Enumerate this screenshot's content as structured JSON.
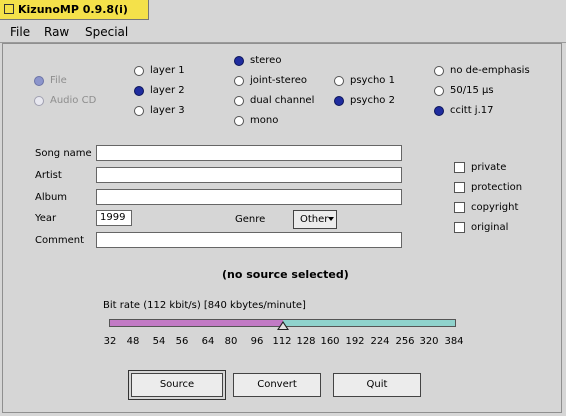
{
  "window": {
    "title": "KizunoMP 0.9.8(i)"
  },
  "menu": {
    "items": [
      "File",
      "Raw",
      "Special"
    ]
  },
  "source": {
    "options": [
      "File",
      "Audio CD"
    ],
    "selected": "File"
  },
  "layer": {
    "options": [
      "layer 1",
      "layer 2",
      "layer 3"
    ],
    "selected": "layer 2"
  },
  "mode": {
    "options": [
      "stereo",
      "joint-stereo",
      "dual channel",
      "mono"
    ],
    "selected": "stereo"
  },
  "psycho": {
    "options": [
      "psycho 1",
      "psycho 2"
    ],
    "selected": "psycho 2"
  },
  "emphasis": {
    "options": [
      "no de-emphasis",
      "50/15 μs",
      "ccitt j.17"
    ],
    "selected": "ccitt j.17"
  },
  "fields": {
    "song_label": "Song name",
    "song_value": "",
    "artist_label": "Artist",
    "artist_value": "",
    "album_label": "Album",
    "album_value": "",
    "year_label": "Year",
    "year_value": "1999",
    "comment_label": "Comment",
    "comment_value": "",
    "genre_label": "Genre",
    "genre_value": "Other"
  },
  "flags": {
    "items": [
      "private",
      "protection",
      "copyright",
      "original"
    ],
    "checked": [
      false,
      false,
      false,
      false
    ]
  },
  "status": "(no source selected)",
  "bitrate": {
    "label": "Bit rate (112 kbit/s) [840 kbytes/minute]",
    "value": 112,
    "ticks": [
      "32",
      "48",
      "54",
      "56",
      "64",
      "80",
      "96",
      "112",
      "128",
      "160",
      "192",
      "224",
      "256",
      "320",
      "384"
    ],
    "left_color": "#c27ac5",
    "right_color": "#8fd2cc"
  },
  "buttons": {
    "source": "Source",
    "convert": "Convert",
    "quit": "Quit"
  }
}
